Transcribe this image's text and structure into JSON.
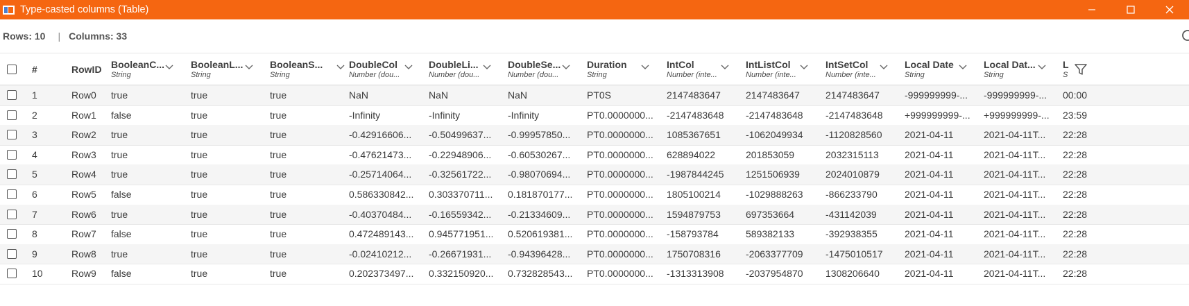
{
  "window": {
    "title": "Type-casted columns (Table)"
  },
  "info": {
    "rows_label": "Rows: 10",
    "separator": "|",
    "columns_label": "Columns: 33"
  },
  "icons": {
    "app": "table-window-icon",
    "minimize": "minimize-icon",
    "maximize": "maximize-icon",
    "close": "close-icon",
    "search": "search-icon",
    "filter": "filter-icon",
    "sort": "chevron-down-icon",
    "checkbox": "checkbox-icon"
  },
  "colors": {
    "titlebar": "#f56611",
    "row_alt": "#f5f5f5"
  },
  "table": {
    "index_header": "#",
    "rowid_header": "RowID",
    "columns": [
      {
        "name": "BooleanC...",
        "type": "String"
      },
      {
        "name": "BooleanL...",
        "type": "String"
      },
      {
        "name": "BooleanS...",
        "type": "String"
      },
      {
        "name": "DoubleCol",
        "type": "Number (dou..."
      },
      {
        "name": "DoubleLi...",
        "type": "Number (dou..."
      },
      {
        "name": "DoubleSe...",
        "type": "Number (dou..."
      },
      {
        "name": "Duration",
        "type": "String"
      },
      {
        "name": "IntCol",
        "type": "Number (inte..."
      },
      {
        "name": "IntListCol",
        "type": "Number (inte..."
      },
      {
        "name": "IntSetCol",
        "type": "Number (inte..."
      },
      {
        "name": "Local Date",
        "type": "String"
      },
      {
        "name": "Local Dat...",
        "type": "String"
      },
      {
        "name": "L",
        "type": "S"
      }
    ],
    "rows": [
      {
        "index": "1",
        "rowid": "Row0",
        "cells": [
          "true",
          "true",
          "true",
          "NaN",
          "NaN",
          "NaN",
          "PT0S",
          "2147483647",
          "2147483647",
          "2147483647",
          "-999999999-...",
          "-999999999-...",
          "00:00"
        ]
      },
      {
        "index": "2",
        "rowid": "Row1",
        "cells": [
          "false",
          "true",
          "true",
          "-Infinity",
          "-Infinity",
          "-Infinity",
          "PT0.0000000...",
          "-2147483648",
          "-2147483648",
          "-2147483648",
          "+999999999-...",
          "+999999999-...",
          "23:59"
        ]
      },
      {
        "index": "3",
        "rowid": "Row2",
        "cells": [
          "true",
          "true",
          "true",
          "-0.42916606...",
          "-0.50499637...",
          "-0.99957850...",
          "PT0.0000000...",
          "1085367651",
          "-1062049934",
          "-1120828560",
          "2021-04-11",
          "2021-04-11T...",
          "22:28"
        ]
      },
      {
        "index": "4",
        "rowid": "Row3",
        "cells": [
          "true",
          "true",
          "true",
          "-0.47621473...",
          "-0.22948906...",
          "-0.60530267...",
          "PT0.0000000...",
          "628894022",
          "201853059",
          "2032315113",
          "2021-04-11",
          "2021-04-11T...",
          "22:28"
        ]
      },
      {
        "index": "5",
        "rowid": "Row4",
        "cells": [
          "true",
          "true",
          "true",
          "-0.25714064...",
          "-0.32561722...",
          "-0.98070694...",
          "PT0.0000000...",
          "-1987844245",
          "1251506939",
          "2024010879",
          "2021-04-11",
          "2021-04-11T...",
          "22:28"
        ]
      },
      {
        "index": "6",
        "rowid": "Row5",
        "cells": [
          "false",
          "true",
          "true",
          "0.586330842...",
          "0.303370711...",
          "0.181870177...",
          "PT0.0000000...",
          "1805100214",
          "-1029888263",
          "-866233790",
          "2021-04-11",
          "2021-04-11T...",
          "22:28"
        ]
      },
      {
        "index": "7",
        "rowid": "Row6",
        "cells": [
          "true",
          "true",
          "true",
          "-0.40370484...",
          "-0.16559342...",
          "-0.21334609...",
          "PT0.0000000...",
          "1594879753",
          "697353664",
          "-431142039",
          "2021-04-11",
          "2021-04-11T...",
          "22:28"
        ]
      },
      {
        "index": "8",
        "rowid": "Row7",
        "cells": [
          "false",
          "true",
          "true",
          "0.472489143...",
          "0.945771951...",
          "0.520619381...",
          "PT0.0000000...",
          "-158793784",
          "589382133",
          "-392938355",
          "2021-04-11",
          "2021-04-11T...",
          "22:28"
        ]
      },
      {
        "index": "9",
        "rowid": "Row8",
        "cells": [
          "true",
          "true",
          "true",
          "-0.02410212...",
          "-0.26671931...",
          "-0.94396428...",
          "PT0.0000000...",
          "1750708316",
          "-2063377709",
          "-1475010517",
          "2021-04-11",
          "2021-04-11T...",
          "22:28"
        ]
      },
      {
        "index": "10",
        "rowid": "Row9",
        "cells": [
          "false",
          "true",
          "true",
          "0.202373497...",
          "0.332150920...",
          "0.732828543...",
          "PT0.0000000...",
          "-1313313908",
          "-2037954870",
          "1308206640",
          "2021-04-11",
          "2021-04-11T...",
          "22:28"
        ]
      }
    ]
  }
}
